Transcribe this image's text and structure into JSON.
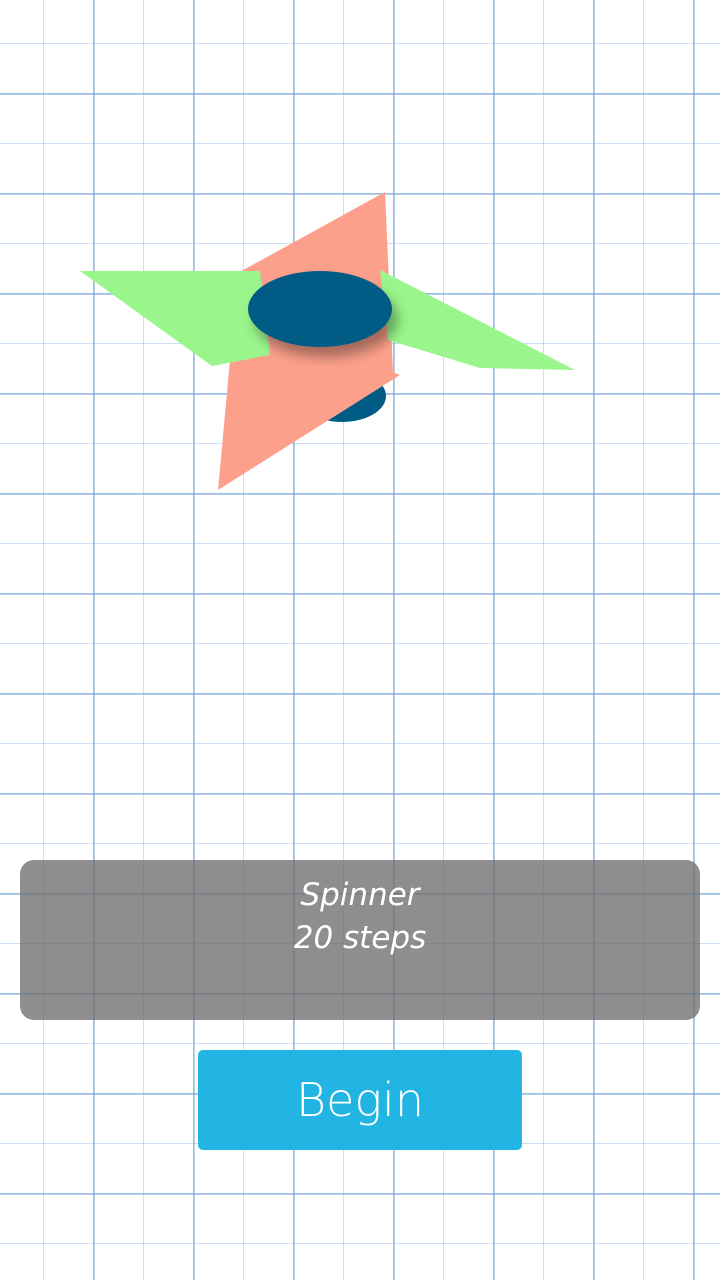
{
  "colors": {
    "blade_green": "#9af68c",
    "blade_salmon": "#fca08b",
    "hub": "#005b85",
    "button": "#22b5e3",
    "panel": "#6e6e6e"
  },
  "illustration": {
    "icon": "fidget-spinner-icon"
  },
  "panel": {
    "title": "Spinner",
    "subtitle": "20 steps"
  },
  "actions": {
    "begin_label": "Begin"
  }
}
